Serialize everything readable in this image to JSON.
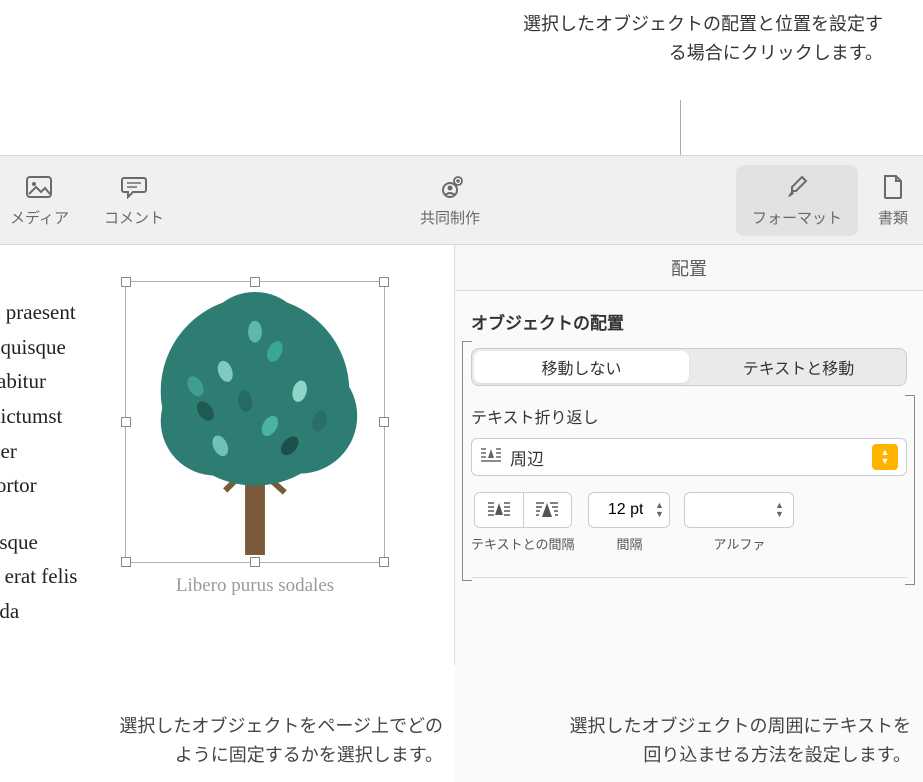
{
  "callouts": {
    "top": "選択したオブジェクトの配置と位置を設定する場合にクリックします。",
    "bottom_left": "選択したオブジェクトをページ上でどのように固定するかを選択します。",
    "bottom_right": "選択したオブジェクトの周囲にテキストを回り込ませる方法を設定します。"
  },
  "toolbar": {
    "media": "メディア",
    "comment": "コメント",
    "collaborate": "共同制作",
    "format": "フォーマット",
    "document": "書類"
  },
  "panel_tab": "配置",
  "document_text": {
    "p1": "d praesent\n. quisque\nrabitur\ndictumst\nper\ntortor",
    "p2": "esque\na erat felis\nada"
  },
  "caption": "Libero purus sodales",
  "inspector": {
    "section_title": "オブジェクトの配置",
    "seg_stay": "移動しない",
    "seg_move": "テキストと移動",
    "wrap_label": "テキスト折り返し",
    "wrap_value": "周辺",
    "text_fit_label": "テキストとの間隔",
    "spacing_value": "12 pt",
    "spacing_label": "間隔",
    "alpha_label": "アルファ"
  }
}
